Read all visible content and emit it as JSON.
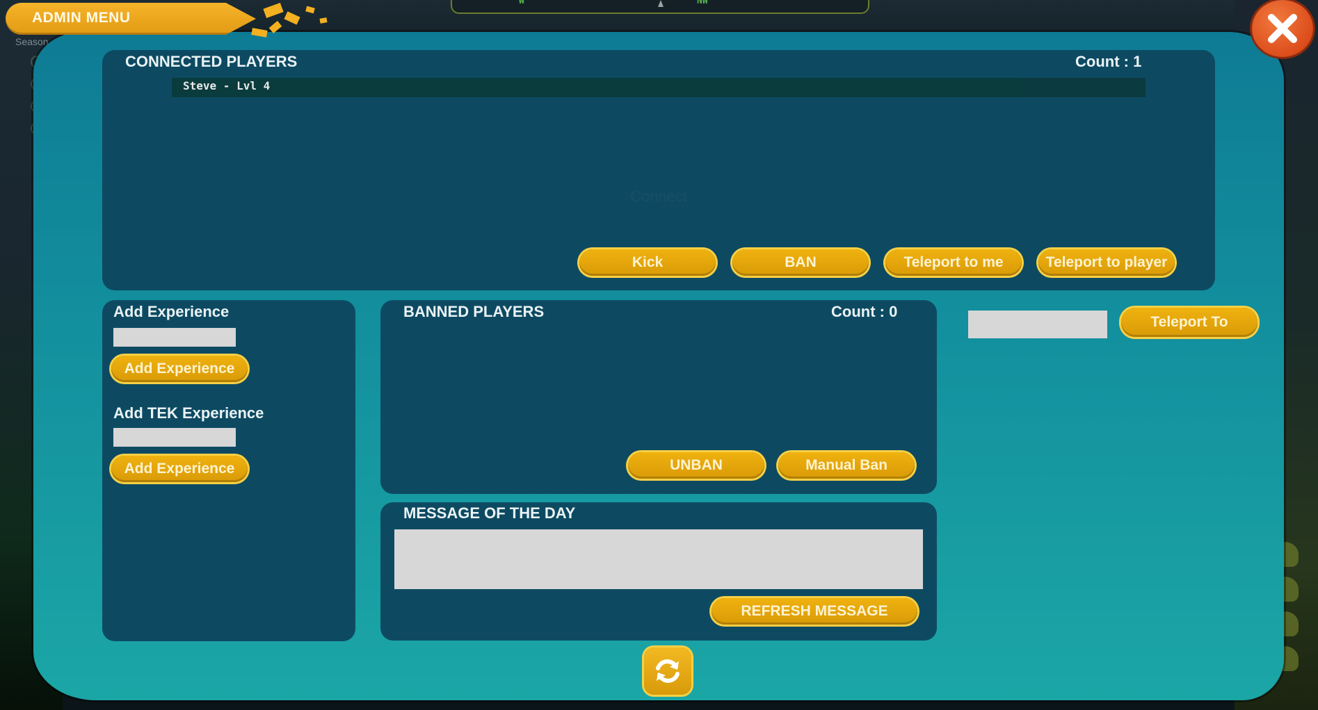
{
  "hud": {
    "season_label": "Season",
    "compass": {
      "marks": [
        "W",
        "NW"
      ]
    }
  },
  "header": {
    "title": "ADMIN MENU"
  },
  "connected_players": {
    "title": "CONNECTED PLAYERS",
    "count_label": "Count :  1",
    "players": [
      {
        "label": "Steve - Lvl 4"
      }
    ],
    "faint_text": "Connect",
    "buttons": {
      "kick": "Kick",
      "ban": "BAN",
      "teleport_to_me": "Teleport to me",
      "teleport_to_player": "Teleport to player"
    }
  },
  "experience": {
    "add_experience_label": "Add Experience",
    "add_experience_value": "",
    "add_experience_button": "Add Experience",
    "add_tek_label": "Add TEK Experience",
    "add_tek_value": "",
    "add_tek_button": "Add Experience"
  },
  "banned_players": {
    "title": "BANNED PLAYERS",
    "count_label": "Count : 0",
    "buttons": {
      "unban": "UNBAN",
      "manual_ban": "Manual Ban"
    }
  },
  "teleport": {
    "value": "",
    "button": "Teleport To"
  },
  "message_of_the_day": {
    "title": "MESSAGE OF THE DAY",
    "value": "",
    "refresh_button": "REFRESH MESSAGE"
  },
  "colors": {
    "panel": "#13909e",
    "section": "#0d4a62",
    "button": "#e3a30c",
    "close": "#dc4d1b"
  },
  "icons": {
    "close": "close-icon",
    "refresh": "refresh-icon"
  }
}
